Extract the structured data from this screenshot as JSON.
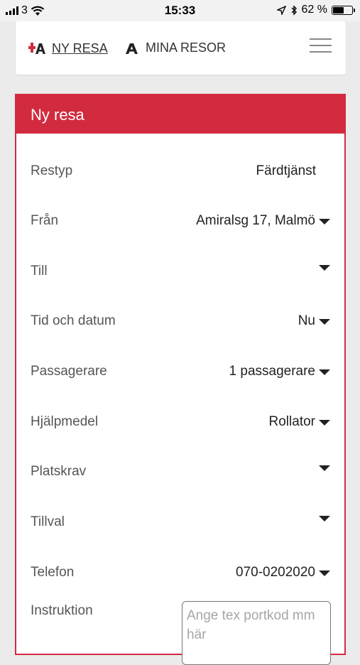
{
  "status_bar": {
    "carrier": "3",
    "time": "15:33",
    "battery": "62 %",
    "battery_level": 0.62,
    "icons": [
      "signal-icon",
      "wifi-icon",
      "location-arrow-icon",
      "bluetooth-icon",
      "battery-icon"
    ]
  },
  "nav": {
    "items": [
      {
        "label": "NY RESA",
        "icon": "ny-resa-logo-icon",
        "active": true
      },
      {
        "label": "MINA RESOR",
        "icon": "mina-resor-logo-icon",
        "active": false
      }
    ],
    "menu_icon": "hamburger-menu-icon"
  },
  "form": {
    "title": "Ny resa",
    "rows": [
      {
        "label": "Restyp",
        "value": "Färdtjänst",
        "dropdown": false
      },
      {
        "label": "Från",
        "value": "Amiralsg 17, Malmö",
        "dropdown": true
      },
      {
        "label": "Till",
        "value": "",
        "dropdown": true
      },
      {
        "label": "Tid och datum",
        "value": "Nu",
        "dropdown": true
      },
      {
        "label": "Passagerare",
        "value": "1 passagerare",
        "dropdown": true
      },
      {
        "label": "Hjälpmedel",
        "value": "Rollator",
        "dropdown": true
      },
      {
        "label": "Platskrav",
        "value": "",
        "dropdown": true
      },
      {
        "label": "Tillval",
        "value": "",
        "dropdown": true
      },
      {
        "label": "Telefon",
        "value": "070-0202020",
        "dropdown": true
      }
    ],
    "instruction": {
      "label": "Instruktion",
      "placeholder": "Ange tex portkod mm här",
      "value": ""
    }
  },
  "colors": {
    "accent": "#d22b3f",
    "background": "#ebebeb",
    "card": "#ffffff"
  }
}
